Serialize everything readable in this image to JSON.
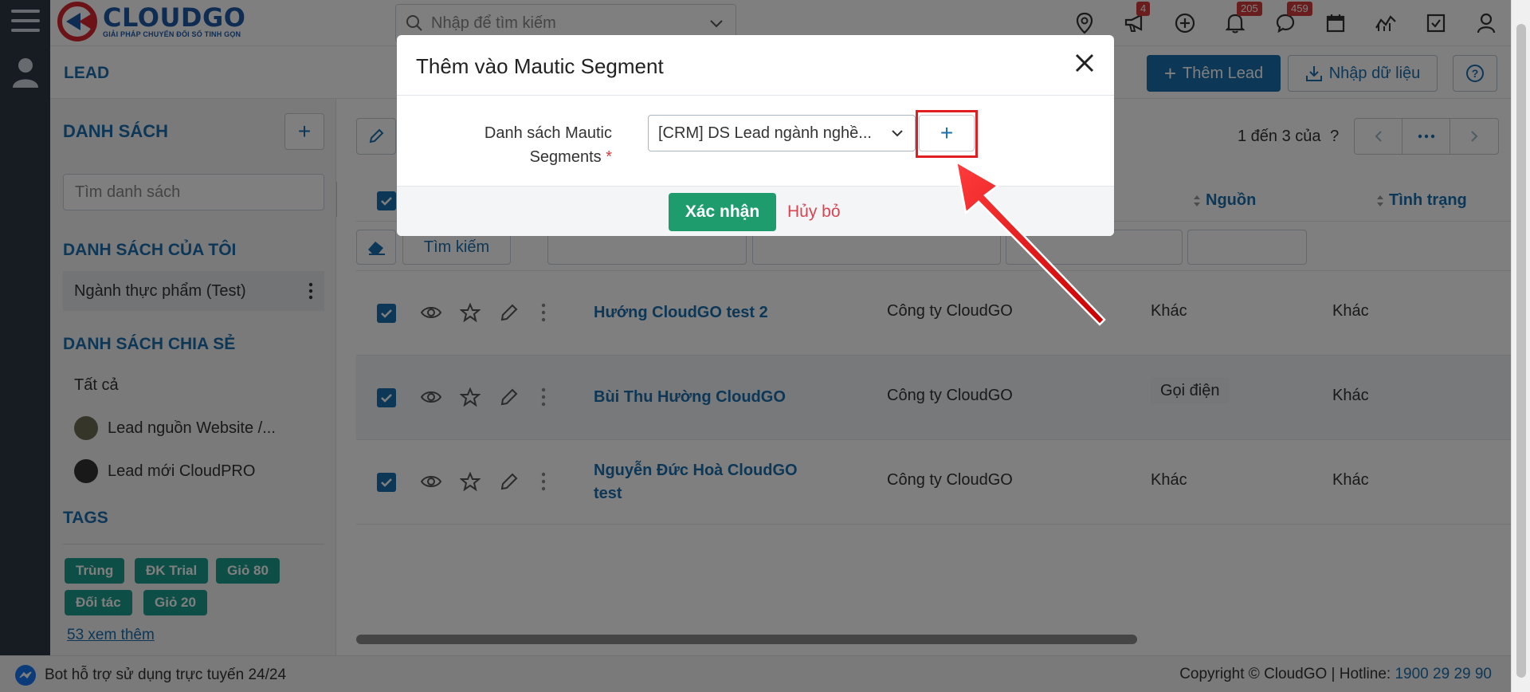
{
  "brand": {
    "name": "CLOUDGO",
    "tagline": "GIẢI PHÁP CHUYỂN ĐỔI SỐ TINH GỌN"
  },
  "search": {
    "placeholder": "Nhập để tìm kiếm"
  },
  "top_icons": [
    {
      "name": "location-icon",
      "badge": ""
    },
    {
      "name": "megaphone-icon",
      "badge": "4"
    },
    {
      "name": "plus-circle-icon",
      "badge": ""
    },
    {
      "name": "bell-icon",
      "badge": "205"
    },
    {
      "name": "chat-icon",
      "badge": "459"
    },
    {
      "name": "calendar-icon",
      "badge": ""
    },
    {
      "name": "chart-icon",
      "badge": ""
    },
    {
      "name": "checkbox-icon",
      "badge": ""
    },
    {
      "name": "user-icon",
      "badge": ""
    }
  ],
  "header": {
    "title": "LEAD",
    "add_label": "Thêm Lead",
    "import_label": "Nhập dữ liệu"
  },
  "sidebar": {
    "title": "DANH SÁCH",
    "search_placeholder": "Tìm danh sách",
    "my_lists_title": "DANH SÁCH CỦA TÔI",
    "my_lists": [
      {
        "label": "Ngành thực phẩm (Test)"
      }
    ],
    "shared_title": "DANH SÁCH CHIA SẺ",
    "shared": [
      {
        "label": "Tất cả"
      },
      {
        "label": "Lead nguồn Website /..."
      },
      {
        "label": "Lead mới CloudPRO"
      }
    ],
    "tags_title": "TAGS",
    "tags": [
      "Trùng",
      "ĐK Trial",
      "Giỏ 80",
      "Đối tác",
      "Giỏ 20"
    ],
    "see_more": "53  xem thêm"
  },
  "main": {
    "paging": "1 đến 3 của",
    "paging_q": "?",
    "columns": {
      "source": "Nguồn",
      "status": "Tình trạng"
    },
    "find_label": "Tìm kiếm",
    "rows": [
      {
        "name": "Hướng CloudGO test 2",
        "company": "Công ty CloudGO",
        "source": "Khác",
        "status": "Khác"
      },
      {
        "name": "Bùi Thu Hường CloudGO",
        "company": "Công ty CloudGO",
        "source": "Gọi điện",
        "status": "Khác"
      },
      {
        "name": "Nguyễn Đức Hoà CloudGO test",
        "company": "Công ty CloudGO",
        "source": "Khác",
        "status": "Khác"
      }
    ]
  },
  "footer": {
    "bot_text": "Bot hỗ trợ sử dụng trực tuyến 24/24",
    "copyright": "Copyright © CloudGO | Hotline: ",
    "hotline": "1900 29 29 90"
  },
  "modal": {
    "title": "Thêm vào Mautic Segment",
    "field_label_1": "Danh sách Mautic",
    "field_label_2": "Segments",
    "required_mark": "*",
    "selected": "[CRM] DS Lead ngành nghề...",
    "add_symbol": "+",
    "confirm_label": "Xác nhận",
    "cancel_label": "Hủy bỏ"
  },
  "colors": {
    "primary": "#1b6fae",
    "success": "#1f9c6e",
    "danger": "#d94452",
    "tag": "#1b9c8c",
    "annotation": "#e02020"
  }
}
